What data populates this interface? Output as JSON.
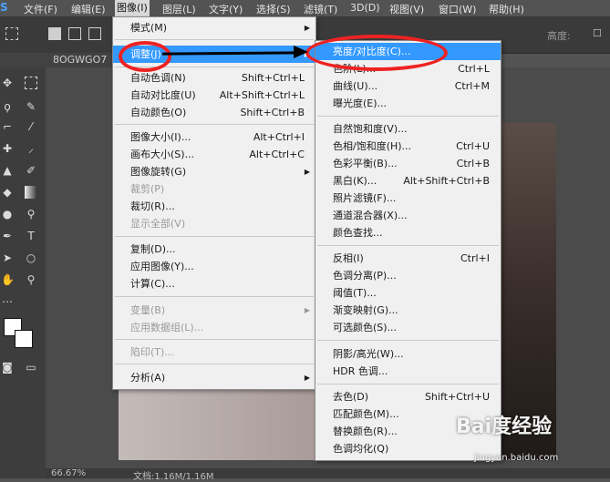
{
  "menubar": {
    "logo": "S",
    "items": [
      "文件(F)",
      "编辑(E)",
      "图像(I)",
      "图层(L)",
      "文字(Y)",
      "选择(S)",
      "滤镜(T)",
      "3D(D)",
      "视图(V)",
      "窗口(W)",
      "帮助(H)"
    ]
  },
  "options": {
    "label_right": "高度:"
  },
  "doc_tab": {
    "title": "8OGWGO7"
  },
  "status": {
    "zoom": "66.67%",
    "doc": "文档:1.16M/1.16M"
  },
  "image_menu": [
    {
      "label": "模式(M)",
      "submenu": true
    },
    {
      "label": "调整(J)",
      "submenu": true,
      "highlighted": true
    },
    {
      "label": "自动色调(N)",
      "shortcut": "Shift+Ctrl+L"
    },
    {
      "label": "自动对比度(U)",
      "shortcut": "Alt+Shift+Ctrl+L"
    },
    {
      "label": "自动颜色(O)",
      "shortcut": "Shift+Ctrl+B"
    },
    {
      "label": "图像大小(I)...",
      "shortcut": "Alt+Ctrl+I"
    },
    {
      "label": "画布大小(S)...",
      "shortcut": "Alt+Ctrl+C"
    },
    {
      "label": "图像旋转(G)",
      "submenu": true
    },
    {
      "label": "裁剪(P)",
      "disabled": true
    },
    {
      "label": "裁切(R)..."
    },
    {
      "label": "显示全部(V)",
      "disabled": true
    },
    {
      "label": "复制(D)..."
    },
    {
      "label": "应用图像(Y)..."
    },
    {
      "label": "计算(C)..."
    },
    {
      "label": "变量(B)",
      "submenu": true,
      "disabled": true
    },
    {
      "label": "应用数据组(L)...",
      "disabled": true
    },
    {
      "label": "陷印(T)...",
      "disabled": true
    },
    {
      "label": "分析(A)",
      "submenu": true
    }
  ],
  "adjust_menu": [
    {
      "label": "亮度/对比度(C)...",
      "highlighted": true
    },
    {
      "label": "色阶(L)...",
      "shortcut": "Ctrl+L"
    },
    {
      "label": "曲线(U)...",
      "shortcut": "Ctrl+M"
    },
    {
      "label": "曝光度(E)..."
    },
    {
      "label": "自然饱和度(V)..."
    },
    {
      "label": "色相/饱和度(H)...",
      "shortcut": "Ctrl+U"
    },
    {
      "label": "色彩平衡(B)...",
      "shortcut": "Ctrl+B"
    },
    {
      "label": "黑白(K)...",
      "shortcut": "Alt+Shift+Ctrl+B"
    },
    {
      "label": "照片滤镜(F)..."
    },
    {
      "label": "通道混合器(X)..."
    },
    {
      "label": "颜色查找..."
    },
    {
      "label": "反相(I)",
      "shortcut": "Ctrl+I"
    },
    {
      "label": "色调分离(P)..."
    },
    {
      "label": "阈值(T)..."
    },
    {
      "label": "渐变映射(G)..."
    },
    {
      "label": "可选颜色(S)..."
    },
    {
      "label": "阴影/高光(W)..."
    },
    {
      "label": "HDR 色调..."
    },
    {
      "label": "去色(D)",
      "shortcut": "Shift+Ctrl+U"
    },
    {
      "label": "匹配颜色(M)..."
    },
    {
      "label": "替换颜色(R)..."
    },
    {
      "label": "色调均化(Q)"
    }
  ],
  "watermark": {
    "brand": "Bai度经验",
    "url": "jingyan.baidu.com"
  }
}
